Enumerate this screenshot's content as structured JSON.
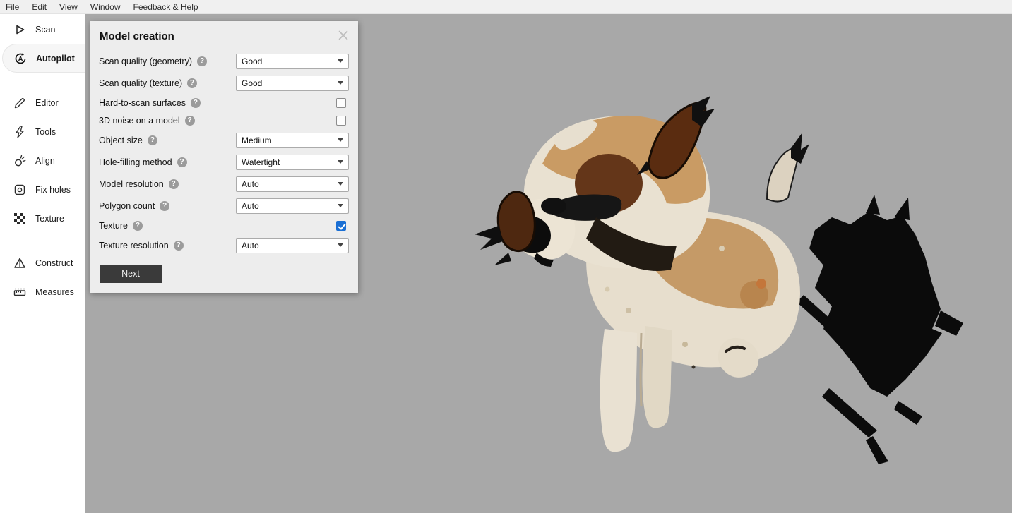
{
  "menu_bar": {
    "items": [
      "File",
      "Edit",
      "View",
      "Window",
      "Feedback & Help"
    ]
  },
  "sidebar": {
    "items": [
      {
        "label": "Scan",
        "active": false
      },
      {
        "label": "Autopilot",
        "active": true
      },
      {
        "label": "Editor",
        "active": false
      },
      {
        "label": "Tools",
        "active": false
      },
      {
        "label": "Align",
        "active": false
      },
      {
        "label": "Fix holes",
        "active": false
      },
      {
        "label": "Texture",
        "active": false
      },
      {
        "label": "Construct",
        "active": false
      },
      {
        "label": "Measures",
        "active": false
      }
    ]
  },
  "dialog": {
    "title": "Model creation",
    "help_glyph": "?",
    "fields": [
      {
        "label": "Scan quality (geometry)",
        "type": "select",
        "value": "Good"
      },
      {
        "label": "Scan quality (texture)",
        "type": "select",
        "value": "Good"
      },
      {
        "label": "Hard-to-scan surfaces",
        "type": "checkbox",
        "checked": false
      },
      {
        "label": "3D noise on a model",
        "type": "checkbox",
        "checked": false
      },
      {
        "label": "Object size",
        "type": "select",
        "value": "Medium"
      },
      {
        "label": "Hole-filling method",
        "type": "select",
        "value": "Watertight"
      },
      {
        "label": "Model resolution",
        "type": "select",
        "value": "Auto"
      },
      {
        "label": "Polygon count",
        "type": "select",
        "value": "Auto"
      },
      {
        "label": "Texture",
        "type": "checkbox",
        "checked": true
      },
      {
        "label": "Texture resolution",
        "type": "select",
        "value": "Auto"
      }
    ],
    "next_button_label": "Next"
  },
  "viewport": {
    "model": "scanned-plush-dog"
  },
  "colors": {
    "checkbox_accent": "#1a6fd4",
    "viewport_bg": "#a8a8a8",
    "dialog_bg": "#ededed",
    "next_button_bg": "#3a3a3a",
    "sidebar_bg": "#ffffff",
    "menubar_bg": "#f0f0f0"
  }
}
